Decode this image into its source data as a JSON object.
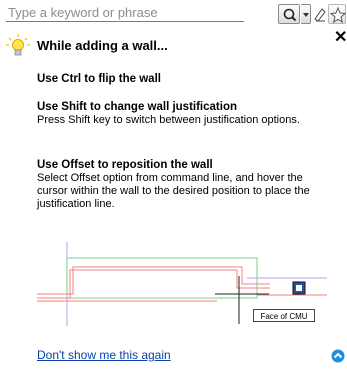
{
  "search": {
    "placeholder": "Type a keyword or phrase"
  },
  "tip": {
    "title": "While adding a wall...",
    "sections": [
      {
        "title": "Use Ctrl to flip the wall",
        "body": ""
      },
      {
        "title": "Use Shift to change wall justification",
        "body": "Press Shift key to switch between justification options."
      },
      {
        "title": "Use Offset to reposition the wall",
        "body": "Select Offset option from command line, and hover the cursor within the wall to the desired position to place the justification line."
      }
    ],
    "illustration_label": "Face of CMU"
  },
  "footer": {
    "dont_show_link": "Don't show me this again"
  },
  "icons": {
    "search": "search-icon",
    "dropdown": "chevron-down-icon",
    "signin": "sign-in-icon",
    "favorite": "star-icon",
    "bulb": "lightbulb-icon",
    "close": "close-icon",
    "collapse": "chevron-up-circle-icon"
  },
  "colors": {
    "link": "#0a3fae",
    "bulb": "#f5c518",
    "collapse_button": "#1a8fe0",
    "wall_lines": "#f08080",
    "wall_outline": "#7ccf8c",
    "guide_line": "#b9a3f0"
  }
}
